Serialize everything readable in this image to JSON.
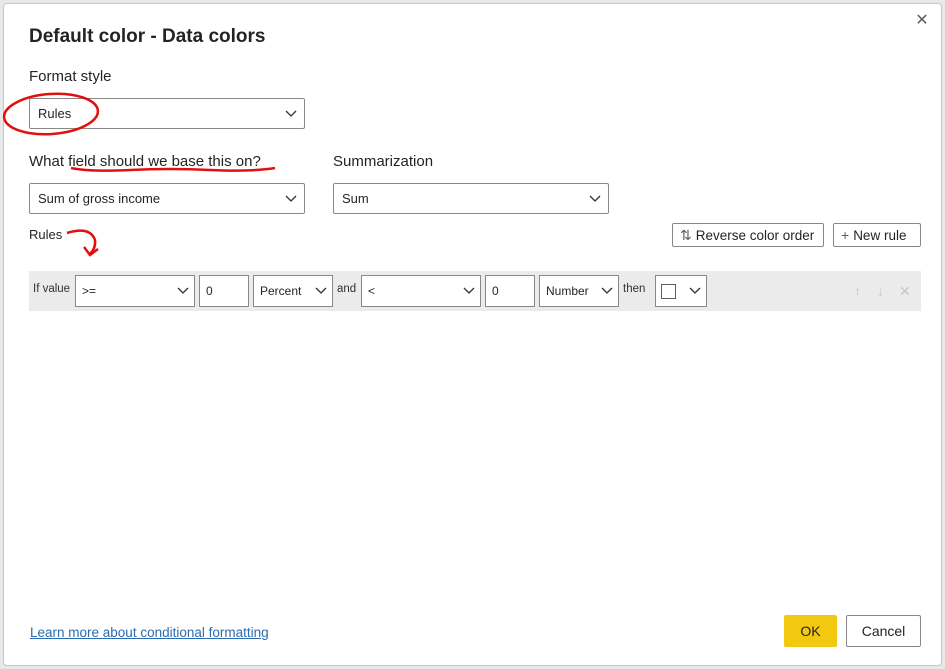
{
  "dialog": {
    "title": "Default color - Data colors",
    "close_glyph": "✕"
  },
  "format_style": {
    "label": "Format style",
    "value": "Rules"
  },
  "field": {
    "label": "What field should we base this on?",
    "value": "Sum of gross income"
  },
  "summarization": {
    "label": "Summarization",
    "value": "Sum"
  },
  "rules_section": {
    "label": "Rules",
    "reverse_label": "Reverse color order",
    "new_rule_label": "New rule"
  },
  "rule": {
    "if_value": "If value",
    "op1": ">=",
    "val1": "0",
    "type1": "Percent",
    "and": "and",
    "op2": "<",
    "val2": "0",
    "type2": "Number",
    "then": "then"
  },
  "footer": {
    "link": "Learn more about conditional formatting",
    "ok": "OK",
    "cancel": "Cancel"
  },
  "colors": {
    "ok_button": "#f2c811",
    "annotation": "#e01010",
    "link": "#2b6cb0"
  }
}
